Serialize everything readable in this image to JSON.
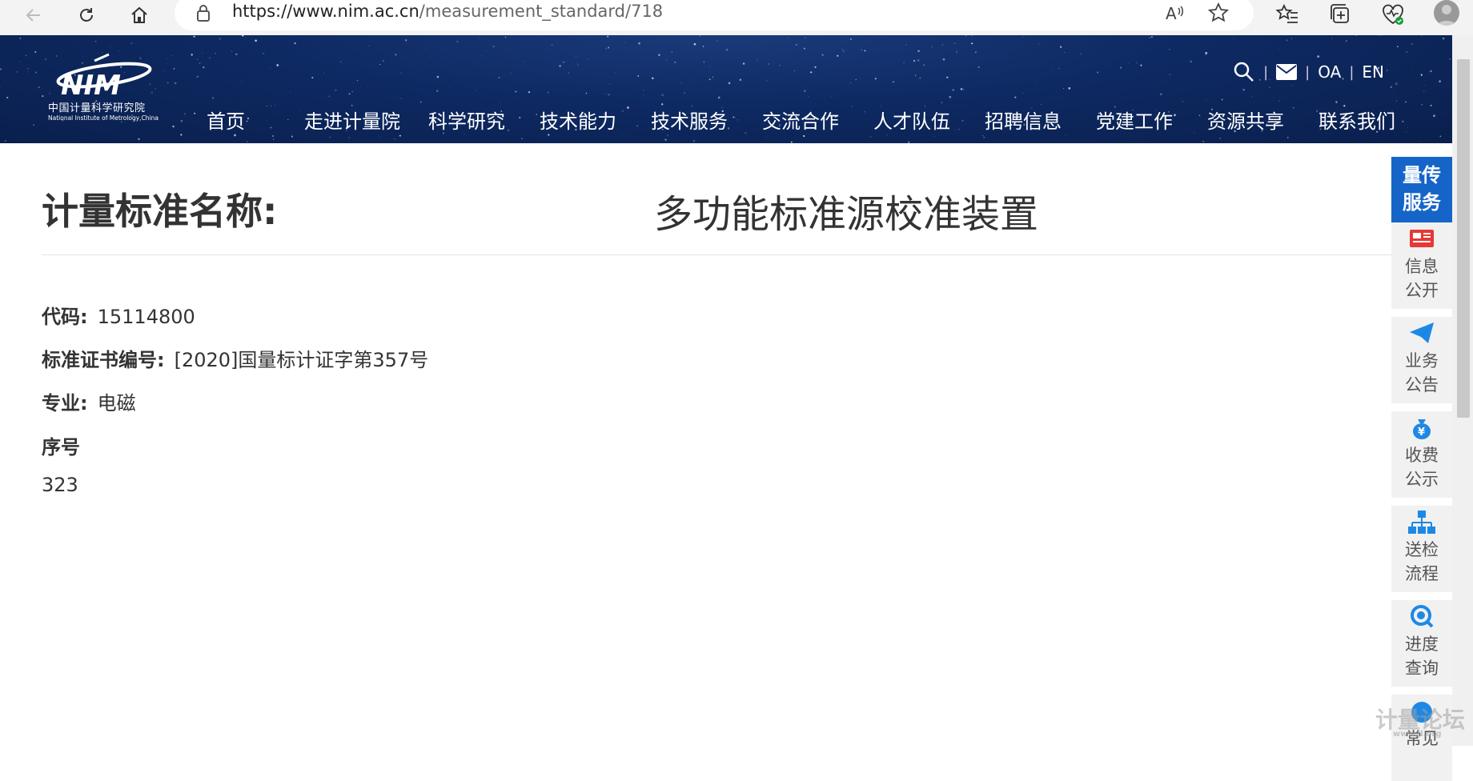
{
  "browser": {
    "url_host": "https://www.nim.ac.cn",
    "url_path": "/measurement_standard/718",
    "read_aloud_label": "A"
  },
  "header": {
    "logo_cn": "中国计量科学研究院",
    "logo_en": "National Institute of Metrology,China",
    "oa": "OA",
    "en": "EN",
    "separator": "|",
    "nav": [
      "首页",
      "走进计量院",
      "科学研究",
      "技术能力",
      "技术服务",
      "交流合作",
      "人才队伍",
      "招聘信息",
      "党建工作",
      "资源共享",
      "联系我们"
    ]
  },
  "content": {
    "title_label": "计量标准名称:",
    "title_value": "多功能标准源校准装置",
    "code_label": "代码:",
    "code_value": "15114800",
    "cert_label": "标准证书编号:",
    "cert_value": "[2020]国量标计证字第357号",
    "major_label": "专业:",
    "major_value": "电磁",
    "seq_label": "序号",
    "seq_value": "323"
  },
  "sidebar": {
    "head_line1": "量传",
    "head_line2": "服务",
    "items": [
      {
        "l1": "信息",
        "l2": "公开",
        "icon": "news-icon"
      },
      {
        "l1": "业务",
        "l2": "公告",
        "icon": "paper-plane-icon"
      },
      {
        "l1": "收费",
        "l2": "公示",
        "icon": "money-bag-icon"
      },
      {
        "l1": "送检",
        "l2": "流程",
        "icon": "flowchart-icon"
      },
      {
        "l1": "进度",
        "l2": "查询",
        "icon": "search-progress-icon"
      },
      {
        "l1": "常见",
        "l2": "",
        "icon": "faq-icon"
      }
    ]
  },
  "watermark": {
    "text": "计量论坛",
    "sub": "www.jl.org"
  },
  "colors": {
    "header_bg": "#0e2a63",
    "accent_blue": "#1565c8",
    "sidebar_bg": "#f1f1f1"
  }
}
